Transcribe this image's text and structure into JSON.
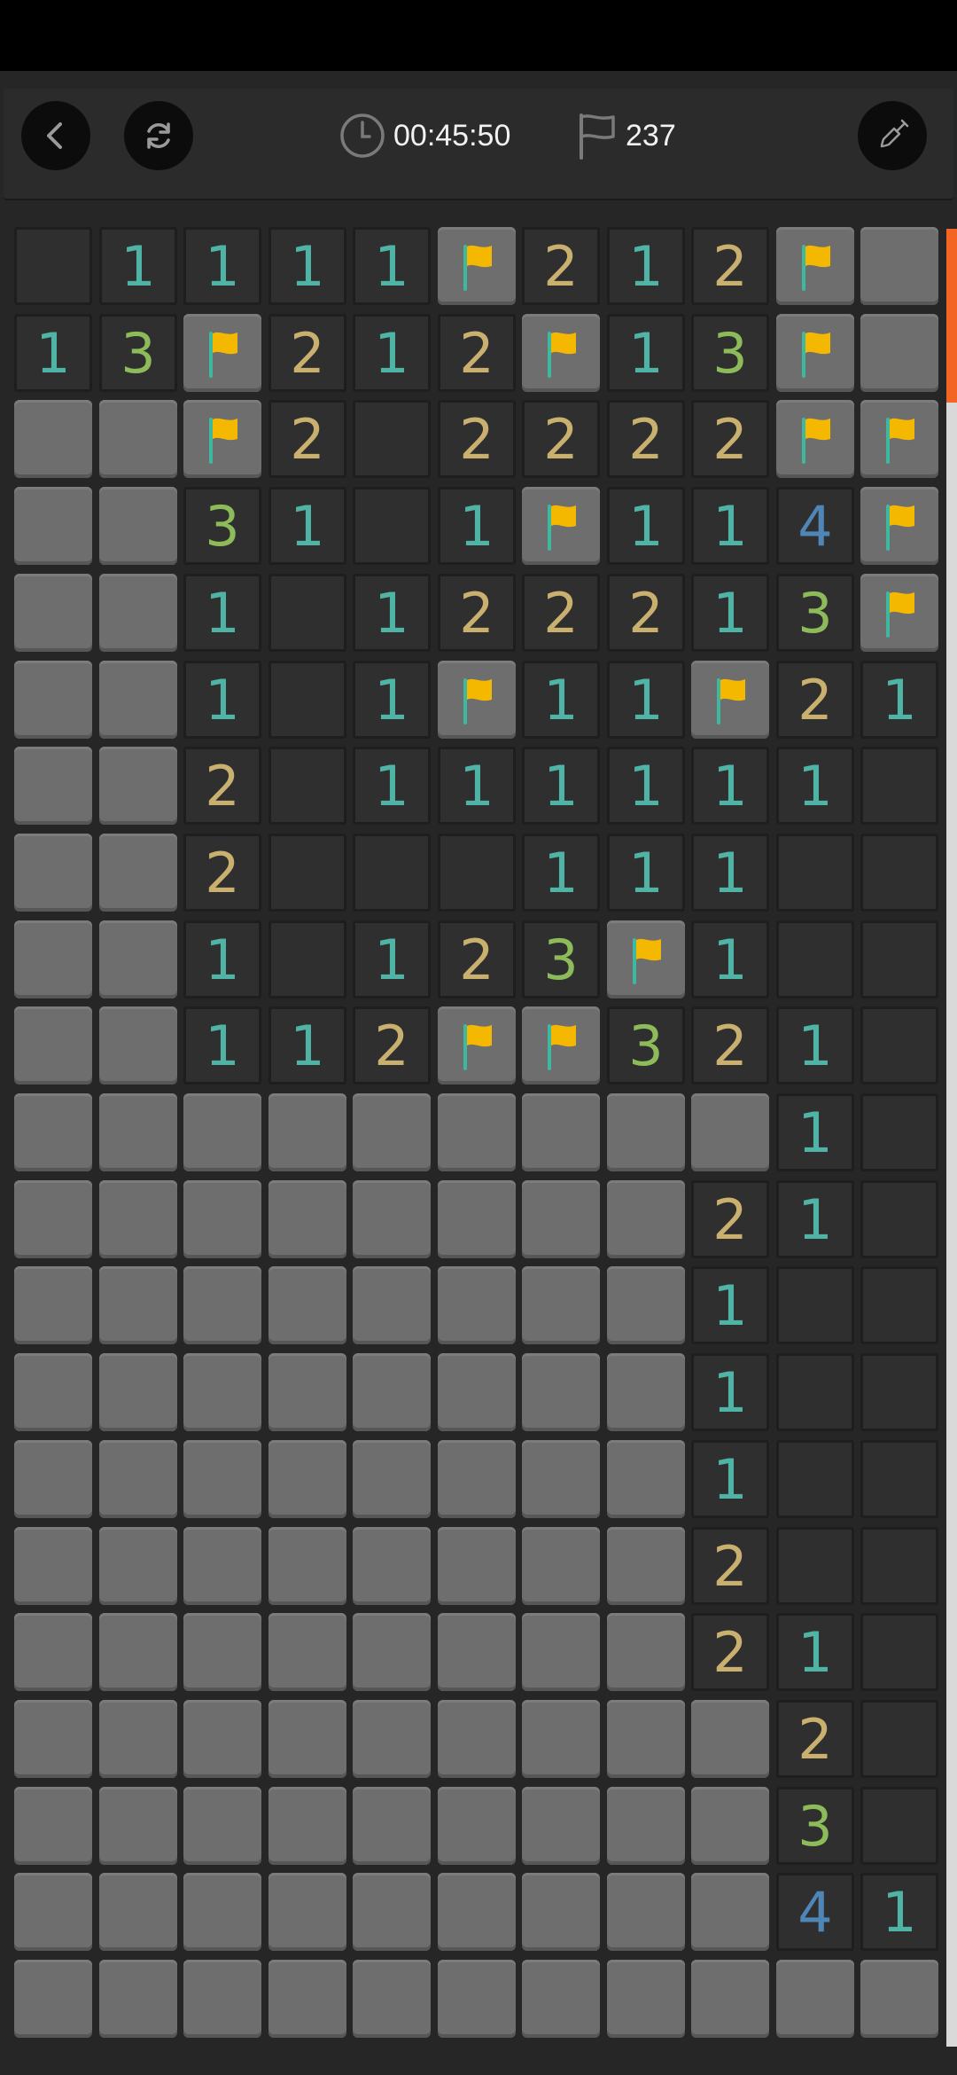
{
  "hud": {
    "timer": "00:45:50",
    "flags_remaining": "237"
  },
  "icons": {
    "back": "chevron-left-icon",
    "restart": "refresh-icon",
    "timer": "clock-icon",
    "flags": "flag-outline-icon",
    "tool": "shovel-icon",
    "cell_flag": "flag-icon"
  },
  "colors": {
    "number_1": "#4fb3a5",
    "number_2": "#c9b06e",
    "number_3": "#8dbb5a",
    "number_4": "#4f86b8",
    "flag": "#f5b800",
    "accent": "#f26522"
  },
  "board": {
    "cols": 11,
    "rows": 21,
    "legend": "H = hidden, F = flagged, . = open empty, 1-9 = open number",
    "grid": [
      ".1111F212FH",
      "13F212F13FH",
      "HHF2.2222FF",
      "HH31.1F114F",
      "HH1.122213F",
      "HH1.1F11F21",
      "HH2.111111.",
      "HH2...111..",
      "HH1.123F1..",
      "HH112FF321.",
      "HHHHHHHHH1.",
      "HHHHHHHH21.",
      "HHHHHHHH1..",
      "HHHHHHHH1..",
      "HHHHHHHH1..",
      "HHHHHHHH2..",
      "HHHHHHHH21.",
      "HHHHHHHHH2.",
      "HHHHHHHHH3.",
      "HHHHHHHHH41",
      "HHHHHHHHHHH"
    ]
  }
}
